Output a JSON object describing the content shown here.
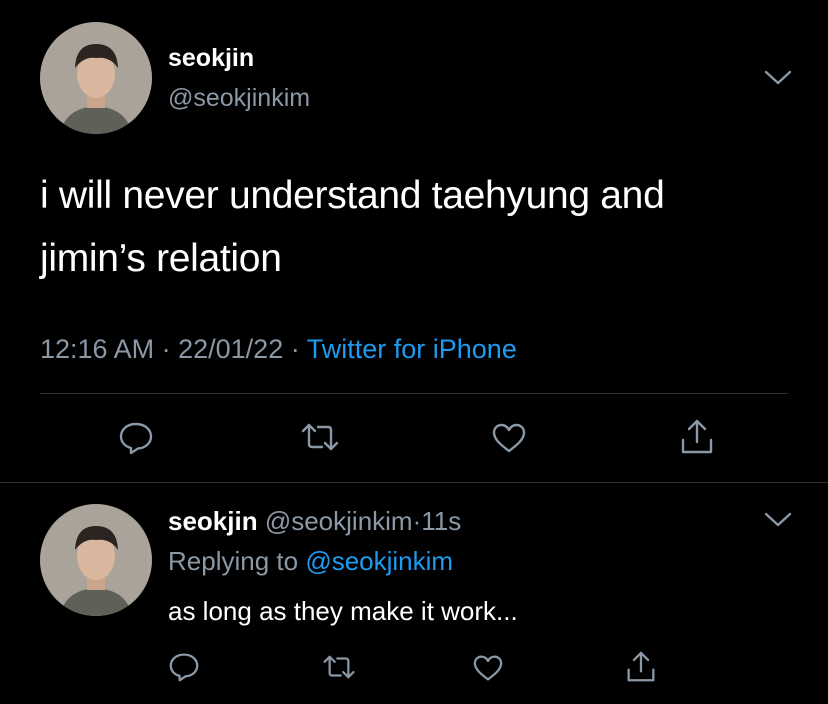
{
  "main_tweet": {
    "display_name": "seokjin",
    "handle": "@seokjinkim",
    "text_line1": "i will never understand taehyung and",
    "text_line2": "jimin’s relation",
    "time": "12:16 AM",
    "sep1": "·",
    "date": "22/01/22",
    "sep2": "·",
    "source": "Twitter for iPhone",
    "actions": [
      "comment-icon",
      "retweet-icon",
      "like-icon",
      "share-icon"
    ]
  },
  "reply_tweet": {
    "display_name": "seokjin",
    "handle": "@seokjinkim",
    "sep": "·",
    "age": "11s",
    "replying_prefix": "Replying to",
    "replying_handle": "@seokjinkim",
    "text": "as long as they make it work...",
    "actions": [
      "comment-icon",
      "retweet-icon",
      "like-icon",
      "share-icon"
    ]
  },
  "colors": {
    "background": "#000000",
    "text": "#ffffff",
    "secondary": "#8b98a5",
    "link": "#1d9bf0",
    "divider": "#2f3336"
  }
}
